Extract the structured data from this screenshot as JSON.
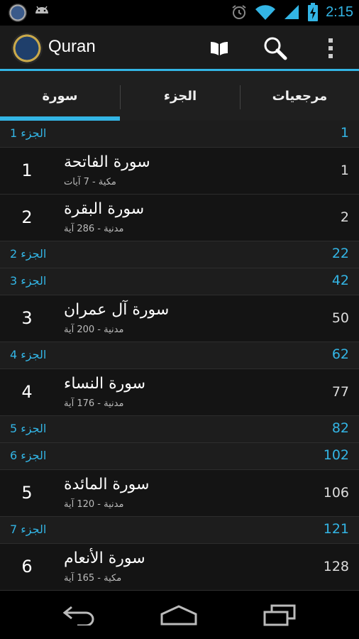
{
  "status_bar": {
    "time": "2:15"
  },
  "action_bar": {
    "title": "Quran"
  },
  "tabs": [
    {
      "label": "سورة",
      "selected": true
    },
    {
      "label": "الجزء",
      "selected": false
    },
    {
      "label": "مرجعيات",
      "selected": false
    }
  ],
  "list": {
    "juz": [
      {
        "name": "الجزء 1",
        "page": "1"
      },
      {
        "name": "الجزء 2",
        "page": "22"
      },
      {
        "name": "الجزء 3",
        "page": "42"
      },
      {
        "name": "الجزء 4",
        "page": "62"
      },
      {
        "name": "الجزء 5",
        "page": "82"
      },
      {
        "name": "الجزء 6",
        "page": "102"
      },
      {
        "name": "الجزء 7",
        "page": "121"
      }
    ],
    "suras": [
      {
        "number": "1",
        "name": "سورة الفاتحة",
        "meta": "مكية - 7 آيات",
        "page": "1"
      },
      {
        "number": "2",
        "name": "سورة البقرة",
        "meta": "مدنية - 286 آية",
        "page": "2"
      },
      {
        "number": "3",
        "name": "سورة آل عمران",
        "meta": "مدنية - 200 آية",
        "page": "50"
      },
      {
        "number": "4",
        "name": "سورة النساء",
        "meta": "مدنية - 176 آية",
        "page": "77"
      },
      {
        "number": "5",
        "name": "سورة المائدة",
        "meta": "مدنية - 120 آية",
        "page": "106"
      },
      {
        "number": "6",
        "name": "سورة الأنعام",
        "meta": "مكية - 165 آية",
        "page": "128"
      }
    ]
  },
  "colors": {
    "accent": "#33b5e5",
    "action_bar": "#1b1b1b",
    "list_bg": "#141414",
    "header_row_bg": "#1d1d1d"
  }
}
